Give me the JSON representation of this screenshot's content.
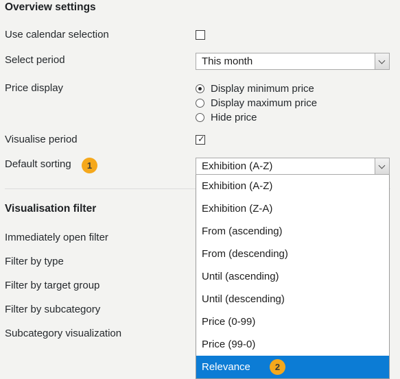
{
  "sections": {
    "overview": {
      "title": "Overview settings",
      "rows": {
        "use_calendar": {
          "label": "Use calendar selection",
          "checked": false
        },
        "select_period": {
          "label": "Select period",
          "value": "This month"
        },
        "price_display": {
          "label": "Price display",
          "options": [
            {
              "label": "Display minimum price",
              "selected": true
            },
            {
              "label": "Display maximum price",
              "selected": false
            },
            {
              "label": "Hide price",
              "selected": false
            }
          ]
        },
        "visualise_period": {
          "label": "Visualise period",
          "checked": true
        },
        "default_sorting": {
          "label": "Default sorting",
          "badge": "1",
          "value": "Exhibition (A-Z)"
        }
      }
    },
    "visualisation_filter": {
      "title": "Visualisation filter",
      "rows": [
        {
          "label": "Immediately open filter"
        },
        {
          "label": "Filter by type"
        },
        {
          "label": "Filter by target group"
        },
        {
          "label": "Filter by subcategory"
        },
        {
          "label": "Subcategory visualization"
        }
      ]
    }
  },
  "sorting_dropdown": {
    "open": true,
    "items": [
      {
        "label": "Exhibition (A-Z)",
        "selected": false
      },
      {
        "label": "Exhibition (Z-A)",
        "selected": false
      },
      {
        "label": "From (ascending)",
        "selected": false
      },
      {
        "label": "From (descending)",
        "selected": false
      },
      {
        "label": "Until (ascending)",
        "selected": false
      },
      {
        "label": "Until (descending)",
        "selected": false
      },
      {
        "label": "Price (0-99)",
        "selected": false
      },
      {
        "label": "Price (99-0)",
        "selected": false
      },
      {
        "label": "Relevance",
        "selected": true,
        "badge": "2"
      }
    ]
  },
  "colors": {
    "background": "#f3f3f1",
    "badge": "#f5a81c",
    "selection_blue": "#0c7cd5",
    "text": "#24282c",
    "border": "#a9a9a9"
  },
  "icons": {
    "chevron_down": "chevron-down-icon",
    "checkmark": "✔"
  }
}
